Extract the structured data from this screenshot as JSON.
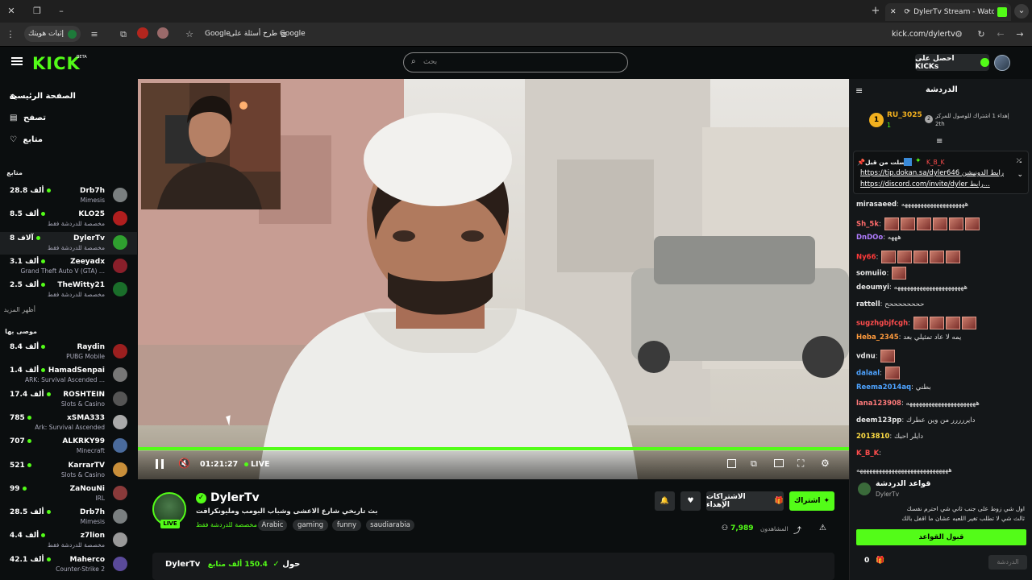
{
  "browser": {
    "tab_title": "DylerTv Stream - Watch Live",
    "url": "kick.com/dylertv",
    "ask_google": "طرح أسئلة على Google",
    "verify_identity": "إثبات هويتك"
  },
  "header": {
    "logo": "KICK",
    "logo_badge": "BETA",
    "search_placeholder": "بحث",
    "get_kicks": "احصل على KICKs"
  },
  "sidebar": {
    "nav": [
      {
        "label": "الصفحة الرئيسية"
      },
      {
        "label": "تصفح"
      },
      {
        "label": "متابع"
      }
    ],
    "following_title": "متابع",
    "following": [
      {
        "name": "Drb7h",
        "category": "Mimesis",
        "count": "28.8 ألف",
        "color": "#7a7f80"
      },
      {
        "name": "KLO25",
        "category": "مخصصة للدردشة فقط",
        "count": "8.5 ألف",
        "color": "#b01e1e"
      },
      {
        "name": "DylerTv",
        "category": "مخصصة للدردشة فقط",
        "count": "8 آلاف",
        "color": "#2fa02f"
      },
      {
        "name": "Zeeyadx",
        "category": "Grand Theft Auto V (GTA) ...",
        "count": "3.1 ألف",
        "color": "#8a1f2a"
      },
      {
        "name": "TheWitty21",
        "category": "مخصصة للدردشة فقط",
        "count": "2.5 ألف",
        "color": "#1a6e2a"
      }
    ],
    "show_more": "أظهر المزيد",
    "recommended_title": "موصى بها",
    "recommended": [
      {
        "name": "Raydin",
        "category": "PUBG Mobile",
        "count": "8.4 ألف",
        "color": "#9b1f1f"
      },
      {
        "name": "HamadSenpai",
        "category": "ARK: Survival Ascended ...",
        "count": "1.4 ألف",
        "color": "#777"
      },
      {
        "name": "ROSHTEIN",
        "category": "Slots & Casino",
        "count": "17.4 ألف",
        "color": "#555"
      },
      {
        "name": "xSMA333",
        "category": "Ark: Survival Ascended",
        "count": "785",
        "color": "#aaa"
      },
      {
        "name": "ALKRKY99",
        "category": "Minecraft",
        "count": "707",
        "color": "#4a6b9c"
      },
      {
        "name": "KarrarTV",
        "category": "Slots & Casino",
        "count": "521",
        "color": "#c98f3a"
      },
      {
        "name": "ZaNouNi",
        "category": "IRL",
        "count": "99",
        "color": "#8a3a3a"
      },
      {
        "name": "Drb7h",
        "category": "Mimesis",
        "count": "28.5 ألف",
        "color": "#7a7f80"
      },
      {
        "name": "z7lion",
        "category": "مخصصة للدردشة فقط",
        "count": "4.4 ألف",
        "color": "#999"
      },
      {
        "name": "Maherco",
        "category": "Counter-Strike 2",
        "count": "42.1 ألف",
        "color": "#5a4a9a"
      }
    ]
  },
  "player": {
    "time": "01:21:27",
    "live": "LIVE",
    "progress": 1.0
  },
  "channel": {
    "name": "DylerTv",
    "title": "بث تاريخي شارع الاعشى وشباب البومب ومليونكرافت",
    "category": "مخصصة للدردشة فقط",
    "tags": [
      "Arabic",
      "gaming",
      "funny",
      "saudiarabia"
    ],
    "avatar_live": "LIVE",
    "viewers": "7,989",
    "viewers_label": "المشاهدون",
    "subscribe": "اشتراك",
    "gift_subs": "الاشتراكات الإهداء",
    "about_prefix": "حول",
    "followers": "150.4 ألف متابع"
  },
  "chat": {
    "title": "الدردشة",
    "leaderboard_user": "RU_3025",
    "leaderboard_count": "1",
    "leaderboard_rank": "1",
    "gift_hint": "إهداء 1 اشتراك للوصول للمركز",
    "gift_rank": "2th",
    "pinned_by_label": "أرسلت من قبل",
    "pinned_user": "K_B_K",
    "pinned_line1": "https://tip.dokan.sa/dyler646 رابط الدونيشن",
    "pinned_line2": "https://discord.com/invite/dyler رابط...",
    "messages": [
      {
        "user": "mirasaeed",
        "color": "#e8e8e8",
        "text": "ههههههههههههههههههههه",
        "emotes": 0
      },
      {
        "user": "Sh_5k",
        "color": "#ff6b6b",
        "text": "",
        "emotes": 6
      },
      {
        "user": "DnDOo",
        "color": "#b07cff",
        "text": "هههه",
        "emotes": 0
      },
      {
        "user": "Ny66",
        "color": "#ff3a3a",
        "text": "",
        "emotes": 5
      },
      {
        "user": "somuiio",
        "color": "#e8e8e8",
        "text": "",
        "emotes": 1
      },
      {
        "user": "deoumyi",
        "color": "#e8e8e8",
        "text": "ههههههههههههههههههههههه",
        "emotes": 0
      },
      {
        "user": "rattell",
        "color": "#e8e8e8",
        "text": "ححححححححح",
        "emotes": 0
      },
      {
        "user": "sugzhgbjfcgh",
        "color": "#ff4d4d",
        "text": "",
        "emotes": 4
      },
      {
        "user": "Heba_2345",
        "color": "#ff9b3d",
        "text": "يمه لا عاد تمثيلي بعد",
        "emotes": 0
      },
      {
        "user": "vdnu",
        "color": "#e8e8e8",
        "text": "",
        "emotes": 1
      },
      {
        "user": "dalaal",
        "color": "#4ea3ff",
        "text": "",
        "emotes": 1
      },
      {
        "user": "Reema2014aq",
        "color": "#4ea3ff",
        "text": "بطني",
        "emotes": 0
      },
      {
        "user": "lana123908",
        "color": "#ff7a7a",
        "text": "ههههههههههههههههههههههه",
        "emotes": 0
      },
      {
        "user": "deem123pp",
        "color": "#e8e8e8",
        "text": "دايررررر من وين عطرك",
        "emotes": 0
      },
      {
        "user": "2013810",
        "color": "#ffdd44",
        "text": "دايلر احبك",
        "emotes": 0
      },
      {
        "user": "K_B_K",
        "color": "#ff4d4d",
        "text": "",
        "emotes": 0
      },
      {
        "user": "",
        "color": "#e8e8e8",
        "text": "هههههههههههههههههههههههههههههه",
        "emotes": 0
      }
    ],
    "rules_title": "قواعد الدردشة",
    "rules_channel": "DylerTv",
    "rules_text_1": "اول شي زوط على جنب ثاني شي احترم نفسك",
    "rules_text_2": "ثالث شي لا تطلب تغير اللعبه عشان ما اقفل بالك",
    "accept_rules": "قبول القواعد",
    "kicks_count": "0",
    "send_placeholder": "الدردشة"
  },
  "colors": {
    "brand": "#53fc18",
    "bg": "#0b0e0f",
    "chat_bg": "#141719"
  }
}
